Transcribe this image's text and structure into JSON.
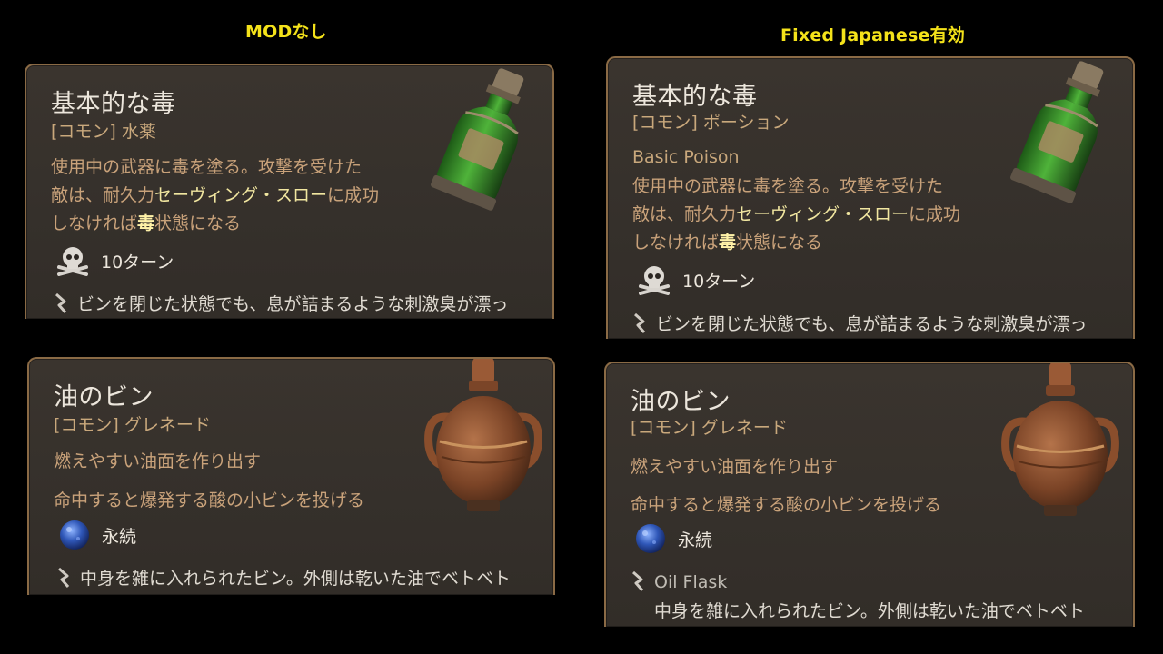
{
  "labels": {
    "left_title": "MODなし",
    "right_title": "Fixed Japanese有効"
  },
  "left": {
    "poison": {
      "name": "基本的な毒",
      "rarity": "[コモン] 水薬",
      "desc1": "使用中の武器に毒を塗る。攻撃を受けた",
      "desc2a": "敵は、耐久力",
      "desc2b": "セーヴィング・スロー",
      "desc2c": "に成功",
      "desc3a": "しなければ",
      "desc3b": "毒",
      "desc3c": "状態になる",
      "duration": "10ターン",
      "flavor": "ビンを閉じた状態でも、息が詰まるような刺激臭が漂っ"
    },
    "oil": {
      "name": "油のビン",
      "rarity": "[コモン] グレネード",
      "line1": "燃えやすい油面を作り出す",
      "line2": "命中すると爆発する酸の小ビンを投げる",
      "duration": "永続",
      "flavor": "中身を雑に入れられたビン。外側は乾いた油でベトベト"
    }
  },
  "right": {
    "poison": {
      "name": "基本的な毒",
      "rarity": "[コモン] ポーション",
      "english": "Basic Poison",
      "desc1": "使用中の武器に毒を塗る。攻撃を受けた",
      "desc2a": "敵は、耐久力",
      "desc2b": "セーヴィング・スロー",
      "desc2c": "に成功",
      "desc3a": "しなければ",
      "desc3b": "毒",
      "desc3c": "状態になる",
      "duration": "10ターン",
      "flavor": "ビンを閉じた状態でも、息が詰まるような刺激臭が漂っ"
    },
    "oil": {
      "name": "油のビン",
      "rarity": "[コモン] グレネード",
      "line1": "燃えやすい油面を作り出す",
      "line2": "命中すると爆発する酸の小ビンを投げる",
      "duration": "永続",
      "flavor_en": "Oil Flask",
      "flavor": "中身を雑に入れられたビン。外側は乾いた油でベトベト"
    }
  },
  "icons": {
    "duration_poison": "skull-crossbones-icon",
    "duration_oil": "blue-orb-icon",
    "flavor": "quill-icon"
  },
  "colors": {
    "title_yellow": "#f4e21a",
    "card_bg": "#36312c",
    "card_border": "#8a6a45",
    "rarity_text": "#c9a87c",
    "highlight_text": "#f1e6a0"
  }
}
